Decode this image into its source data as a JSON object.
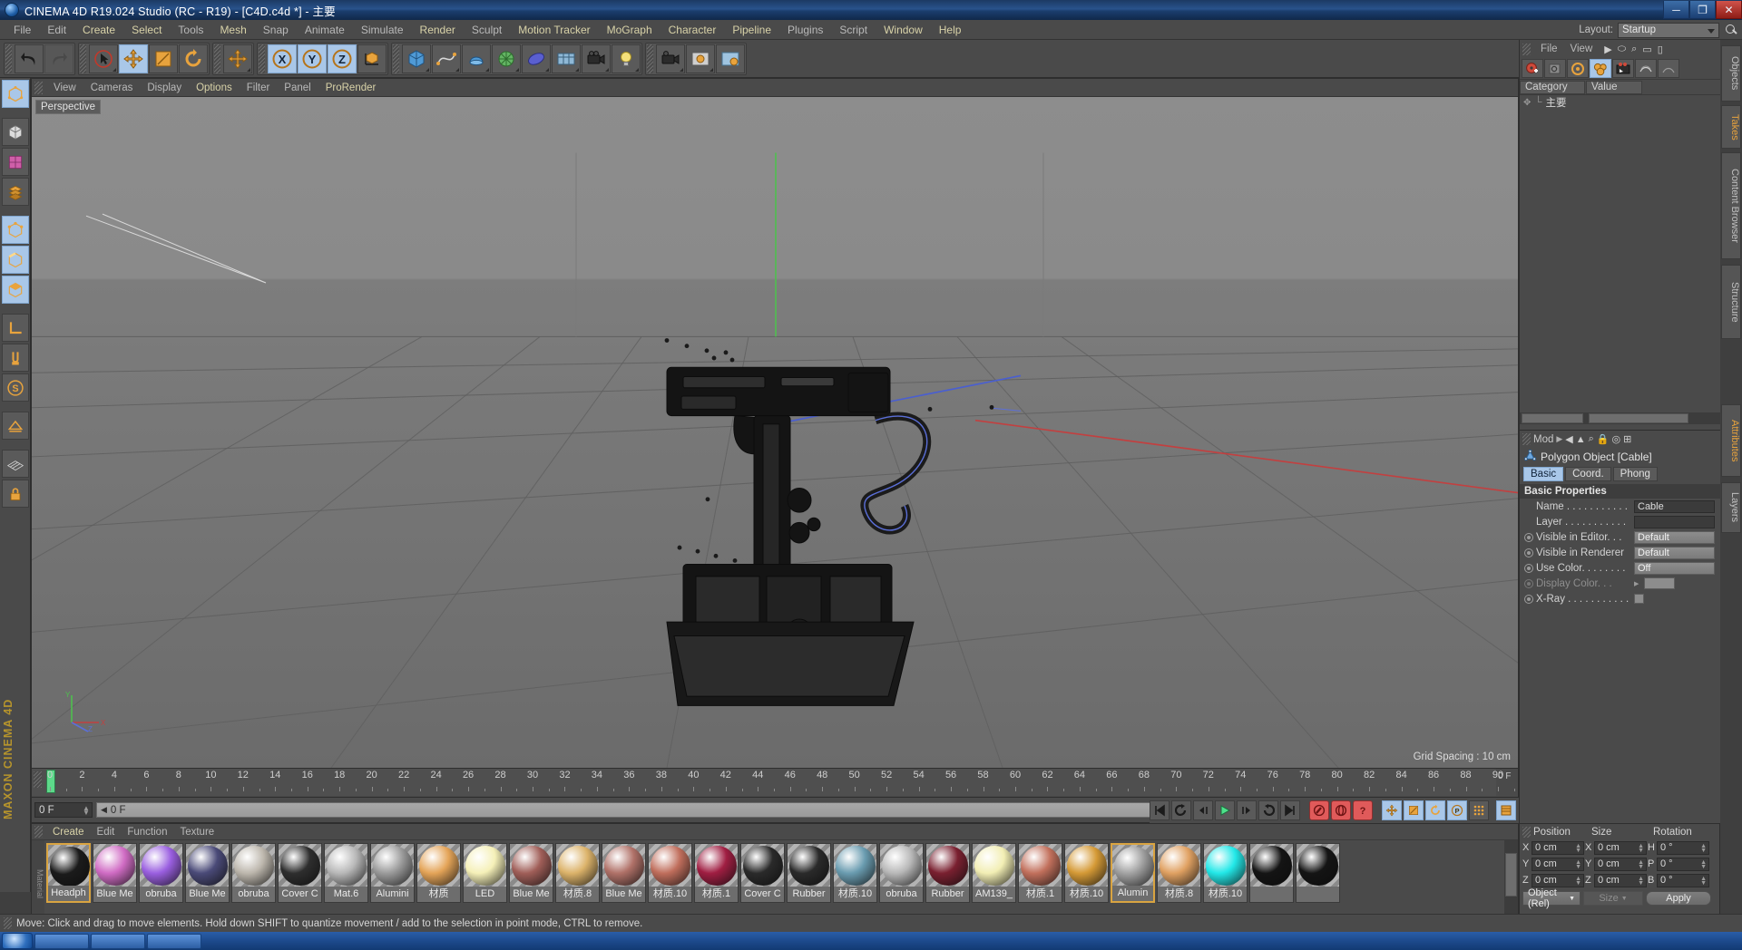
{
  "window": {
    "title": "CINEMA 4D R19.024 Studio (RC - R19) - [C4D.c4d *] - 主要",
    "minimize": "─",
    "maximize": "❐",
    "close": "✕"
  },
  "menu": {
    "items": [
      {
        "label": "File",
        "hl": false
      },
      {
        "label": "Edit",
        "hl": false
      },
      {
        "label": "Create",
        "hl": true
      },
      {
        "label": "Select",
        "hl": true
      },
      {
        "label": "Tools",
        "hl": false
      },
      {
        "label": "Mesh",
        "hl": true
      },
      {
        "label": "Snap",
        "hl": false
      },
      {
        "label": "Animate",
        "hl": false
      },
      {
        "label": "Simulate",
        "hl": false
      },
      {
        "label": "Render",
        "hl": true
      },
      {
        "label": "Sculpt",
        "hl": false
      },
      {
        "label": "Motion Tracker",
        "hl": true
      },
      {
        "label": "MoGraph",
        "hl": true
      },
      {
        "label": "Character",
        "hl": true
      },
      {
        "label": "Pipeline",
        "hl": true
      },
      {
        "label": "Plugins",
        "hl": false
      },
      {
        "label": "Script",
        "hl": false
      },
      {
        "label": "Window",
        "hl": true
      },
      {
        "label": "Help",
        "hl": true
      }
    ],
    "layout_label": "Layout:",
    "layout_value": "Startup"
  },
  "viewport": {
    "menu": [
      {
        "label": "View",
        "hl": false
      },
      {
        "label": "Cameras",
        "hl": false
      },
      {
        "label": "Display",
        "hl": false
      },
      {
        "label": "Options",
        "hl": true
      },
      {
        "label": "Filter",
        "hl": false
      },
      {
        "label": "Panel",
        "hl": false
      },
      {
        "label": "ProRender",
        "hl": true
      }
    ],
    "label": "Perspective",
    "grid_spacing": "Grid Spacing : 10 cm",
    "axis_x": "X",
    "axis_y": "Y",
    "axis_z": "Z"
  },
  "timeline": {
    "ticks": [
      "0",
      "2",
      "4",
      "6",
      "8",
      "10",
      "12",
      "14",
      "16",
      "18",
      "20",
      "22",
      "24",
      "26",
      "28",
      "30",
      "32",
      "34",
      "36",
      "38",
      "40",
      "42",
      "44",
      "46",
      "48",
      "50",
      "52",
      "54",
      "56",
      "58",
      "60",
      "62",
      "64",
      "66",
      "68",
      "70",
      "72",
      "74",
      "76",
      "78",
      "80",
      "82",
      "84",
      "86",
      "88",
      "90"
    ],
    "end_right": "0 F",
    "current_frame": "0 F",
    "preview_start": "0 F",
    "preview_end": "90 F",
    "doc_end": "90 F"
  },
  "object_manager": {
    "menu": [
      "File",
      "View"
    ],
    "tree_root": "主要",
    "columns": [
      "Category",
      "Value"
    ]
  },
  "attributes": {
    "mode_label": "Mod",
    "object_title": "Polygon Object [Cable]",
    "tabs": [
      {
        "label": "Basic",
        "on": true
      },
      {
        "label": "Coord.",
        "on": false
      },
      {
        "label": "Phong",
        "on": false
      }
    ],
    "section": "Basic Properties",
    "rows": [
      {
        "label": "Name . . . . . . . . . . .",
        "value": "Cable",
        "type": "text",
        "radio": false,
        "dim": false
      },
      {
        "label": "Layer  . . . . . . . . . . .",
        "value": "",
        "type": "text",
        "radio": false,
        "dim": false
      },
      {
        "label": "Visible in Editor. . .",
        "value": "Default",
        "type": "button",
        "radio": true,
        "dim": false
      },
      {
        "label": "Visible in Renderer",
        "value": "Default",
        "type": "button",
        "radio": true,
        "dim": false
      },
      {
        "label": "Use Color. . . . . . . .",
        "value": "Off",
        "type": "button",
        "radio": true,
        "dim": false
      },
      {
        "label": "Display Color. . .",
        "value": "",
        "type": "swatch",
        "radio": true,
        "dim": true
      },
      {
        "label": "X-Ray . . . . . . . . . . .",
        "value": "",
        "type": "check",
        "radio": true,
        "dim": false
      }
    ]
  },
  "coordinates": {
    "headers": [
      "Position",
      "Size",
      "Rotation"
    ],
    "rows": [
      {
        "a1": "X",
        "v1": "0 cm",
        "a2": "X",
        "v2": "0 cm",
        "a3": "H",
        "v3": "0 °"
      },
      {
        "a1": "Y",
        "v1": "0 cm",
        "a2": "Y",
        "v2": "0 cm",
        "a3": "P",
        "v3": "0 °"
      },
      {
        "a1": "Z",
        "v1": "0 cm",
        "a2": "Z",
        "v2": "0 cm",
        "a3": "B",
        "v3": "0 °"
      }
    ],
    "mode": "Object (Rel)",
    "size_mode": "Size",
    "apply": "Apply"
  },
  "materials": {
    "menu": [
      {
        "label": "Create",
        "hl": true
      },
      {
        "label": "Edit",
        "hl": false
      },
      {
        "label": "Function",
        "hl": false
      },
      {
        "label": "Texture",
        "hl": false
      }
    ],
    "side_label": "Material",
    "items": [
      {
        "name": "Headph",
        "color": "#1b1b1b",
        "sel": true
      },
      {
        "name": "Blue Me",
        "color": "#d06cc4",
        "sel": false
      },
      {
        "name": "obruba",
        "color": "#9a5fe0",
        "sel": false
      },
      {
        "name": "Blue Me",
        "color": "#4a4a78",
        "sel": false
      },
      {
        "name": "obruba",
        "color": "#bdb7ad",
        "sel": false
      },
      {
        "name": "Cover C",
        "color": "#2e2e2e",
        "sel": false
      },
      {
        "name": "Mat.6",
        "color": "#b8b8b8",
        "sel": false
      },
      {
        "name": "Alumini",
        "color": "#9b9b9b",
        "sel": false
      },
      {
        "name": "材质",
        "color": "#e4a458",
        "sel": false
      },
      {
        "name": "LED",
        "color": "#f5f0b8",
        "sel": false
      },
      {
        "name": "Blue Me",
        "color": "#a05e58",
        "sel": false
      },
      {
        "name": "材质.8",
        "color": "#dcb36a",
        "sel": false
      },
      {
        "name": "Blue Me",
        "color": "#b07168",
        "sel": false
      },
      {
        "name": "材质.10",
        "color": "#c06e5c",
        "sel": false
      },
      {
        "name": "材质.1",
        "color": "#a01e42",
        "sel": false
      },
      {
        "name": "Cover C",
        "color": "#2a2a2a",
        "sel": false
      },
      {
        "name": "Rubber",
        "color": "#2a2a2a",
        "sel": false
      },
      {
        "name": "材质.10",
        "color": "#6a9cb0",
        "sel": false
      },
      {
        "name": "obruba",
        "color": "#b8b8b8",
        "sel": false
      },
      {
        "name": "Rubber",
        "color": "#7a2030",
        "sel": false
      },
      {
        "name": "AM139_",
        "color": "#f2eeb4",
        "sel": false
      },
      {
        "name": "材质.1",
        "color": "#c2705c",
        "sel": false
      },
      {
        "name": "材质.10",
        "color": "#d59a36",
        "sel": false
      },
      {
        "name": "Alumin",
        "color": "#9e9e9e",
        "sel": true
      },
      {
        "name": "材质.8",
        "color": "#e0a162",
        "sel": false
      },
      {
        "name": "材质.10",
        "color": "#22e8e8",
        "sel": false
      },
      {
        "name": "",
        "color": "#141414",
        "sel": false
      },
      {
        "name": "",
        "color": "#141414",
        "sel": false
      }
    ]
  },
  "vertical_tabs": [
    {
      "label": "Objects",
      "on": false
    },
    {
      "label": "Takes",
      "on": true
    },
    {
      "label": "Content Browser",
      "on": false
    },
    {
      "label": "Structure",
      "on": false
    },
    {
      "label": "Attributes",
      "on": true
    },
    {
      "label": "Layers",
      "on": false
    }
  ],
  "status": {
    "message": "Move: Click and drag to move elements. Hold down SHIFT to quantize movement / add to the selection in point mode, CTRL to remove."
  },
  "colors": {
    "panel": "#4a4a4a",
    "accent_blue": "#a9c7e8",
    "accent_orange": "#e8a33d",
    "highlight_yellow": "#d8d2a8",
    "playhead_green": "#5dd98a"
  }
}
